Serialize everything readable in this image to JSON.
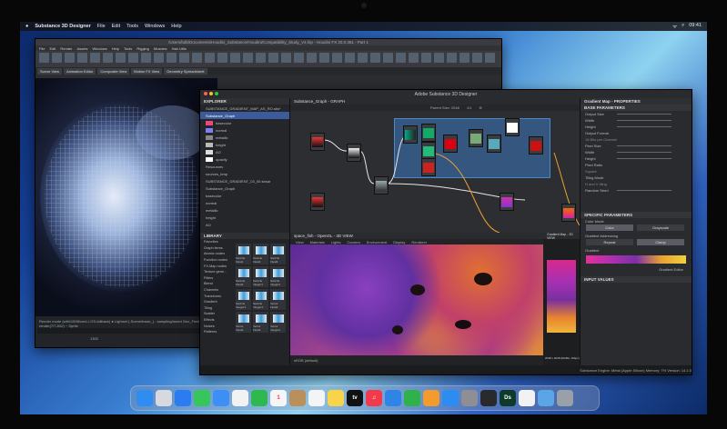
{
  "menubar": {
    "app_name": "Substance 3D Designer",
    "items": [
      "File",
      "Edit",
      "Tools",
      "Windows",
      "Help"
    ],
    "right": [
      "ᯤ",
      "⌕",
      "09:41"
    ]
  },
  "houdini": {
    "title": "/Users/bdb/Documents/Houdini_Substance/Houdini/Compatibility_Study_V4.hip - Houdini FX 20.0.351 - Part 1",
    "menu": [
      "File",
      "Edit",
      "Render",
      "Assets",
      "Windows",
      "Help",
      "Tools",
      "Rigging",
      "Muscles",
      "Hair Utils"
    ],
    "tabs": [
      "Scene View",
      "Animation Editor",
      "Composite View",
      "Motion FX View",
      "Geometry Spreadsheet"
    ],
    "timeline_text": "Render mode (with/1598/cmd-/-OS-fallback) ● Lightset (-Scene/basic_) - sampling/tuned Geo_Field ~ render(7/7-0/0/) ~ Sprite",
    "frame_value": "1300"
  },
  "substance": {
    "title": "Adobe Substance 3D Designer",
    "explorer": {
      "header": "EXPLORER",
      "items": [
        "SUBSTANCE_GRADIENT_MAP_AS_RO.sbs*",
        "Substance_Graph",
        "basecolor",
        "normal",
        "metallic",
        "height",
        "AO",
        "opacity",
        "Resources",
        "sources_bmp",
        "SUBSTANCE_GRADIENT_03_00.sbsar",
        "Substance_Graph",
        "basecolor",
        "normal",
        "metallic",
        "height",
        "AO"
      ]
    },
    "library": {
      "header": "LIBRARY",
      "categories": [
        "Favorites",
        "Graph items",
        "Atomic nodes",
        "Function nodes",
        "FX-Map nodes",
        "Texture gene...",
        "Filters",
        "Blend",
        "Channels",
        "Transforms",
        "Gradient",
        "Tiling",
        "Scatter",
        "Effects",
        "Noises",
        "Patterns"
      ],
      "tiles": [
        "Swizzle Float1",
        "Swizzle Float2",
        "Swizzle Float3",
        "Swizzle Float4",
        "Swizzle Integer1",
        "Swizzle Integer2",
        "Swizzle Integer3",
        "Swizzle Integer4",
        "Vector Float2",
        "Vector Float3",
        "Vector Float4",
        "Vector Integer2"
      ]
    },
    "graph": {
      "header": "Substance_Graph - GRAPH",
      "toolbar": [
        "Parent Size: 2048",
        "1/1",
        "⊕"
      ]
    },
    "view3d": {
      "header": "space_fish - OpenGL - 3D VIEW",
      "menu": [
        "View",
        "Materials",
        "Lights",
        "Camera",
        "Environment",
        "Display",
        "Renderer"
      ],
      "footer": "sRGB (default)"
    },
    "view2d": {
      "header": "Gradient Map - 2D VIEW",
      "footer": "2048 x 2048 (RGBA, 16bpc)"
    },
    "params": {
      "header": "Gradient Map - PROPERTIES",
      "base_section": "BASE PARAMETERS",
      "rows": [
        {
          "label": "Output Size",
          "value": "1"
        },
        {
          "label": "Width",
          "value": "1"
        },
        {
          "label": "Height",
          "value": "1"
        },
        {
          "label": "Output Format",
          "value": "16 Bits per Channel"
        },
        {
          "label": "Pixel Size",
          "value": "1"
        },
        {
          "label": "Width",
          "value": "1"
        },
        {
          "label": "Height",
          "value": "1"
        },
        {
          "label": "Pixel Ratio",
          "value": "Square"
        },
        {
          "label": "Tiling Mode",
          "value": "H and V tiling"
        },
        {
          "label": "Random Seed",
          "value": "0"
        }
      ],
      "specific_section": "SPECIFIC PARAMETERS",
      "color_mode_label": "Color Mode",
      "color_mode_options": [
        "Color",
        "Grayscale"
      ],
      "addressing_label": "Gradient Addressing",
      "addressing_options": [
        "Repeat",
        "Clamp"
      ],
      "gradient_label": "Gradient",
      "gradient_editor": "Gradient Editor",
      "input_values": "INPUT VALUES"
    },
    "statusbar": {
      "left": "",
      "right": "Substance Engine: Metal (Apple Silicon)  Memory: 7%    Version: 14.1.0"
    }
  },
  "dock": {
    "apps": [
      {
        "name": "Finder",
        "color": "#2f8cf0",
        "glyph": ""
      },
      {
        "name": "Launchpad",
        "color": "#d8d9df",
        "glyph": ""
      },
      {
        "name": "Safari",
        "color": "#2b7cf0",
        "glyph": ""
      },
      {
        "name": "Messages",
        "color": "#35c759",
        "glyph": ""
      },
      {
        "name": "Mail",
        "color": "#3d8ef5",
        "glyph": ""
      },
      {
        "name": "Photos",
        "color": "#f2f2f2",
        "glyph": ""
      },
      {
        "name": "FaceTime",
        "color": "#2fb84f",
        "glyph": ""
      },
      {
        "name": "Calendar",
        "color": "#f5f5f5",
        "glyph": "1"
      },
      {
        "name": "Contacts",
        "color": "#b9905c",
        "glyph": ""
      },
      {
        "name": "Reminders",
        "color": "#f4f4f4",
        "glyph": ""
      },
      {
        "name": "Notes",
        "color": "#f7d44a",
        "glyph": ""
      },
      {
        "name": "Apple TV",
        "color": "#111111",
        "glyph": "tv"
      },
      {
        "name": "Music",
        "color": "#f23a4c",
        "glyph": "♫"
      },
      {
        "name": "Keynote",
        "color": "#2f84e8",
        "glyph": ""
      },
      {
        "name": "Numbers",
        "color": "#2fb24c",
        "glyph": ""
      },
      {
        "name": "Pages",
        "color": "#f59a2c",
        "glyph": ""
      },
      {
        "name": "App Store",
        "color": "#2c8cf2",
        "glyph": ""
      },
      {
        "name": "System Settings",
        "color": "#8e8e93",
        "glyph": ""
      },
      {
        "name": "iPhone Mirroring",
        "color": "#2a2a2e",
        "glyph": ""
      },
      {
        "name": "Substance 3D Designer",
        "color": "#0e3a2a",
        "glyph": "Ds"
      },
      {
        "name": "Houdini",
        "color": "#f2f2f2",
        "glyph": ""
      },
      {
        "name": "Downloads",
        "color": "#5aa5e6",
        "glyph": ""
      },
      {
        "name": "Trash",
        "color": "#9aa0a8",
        "glyph": ""
      }
    ]
  }
}
